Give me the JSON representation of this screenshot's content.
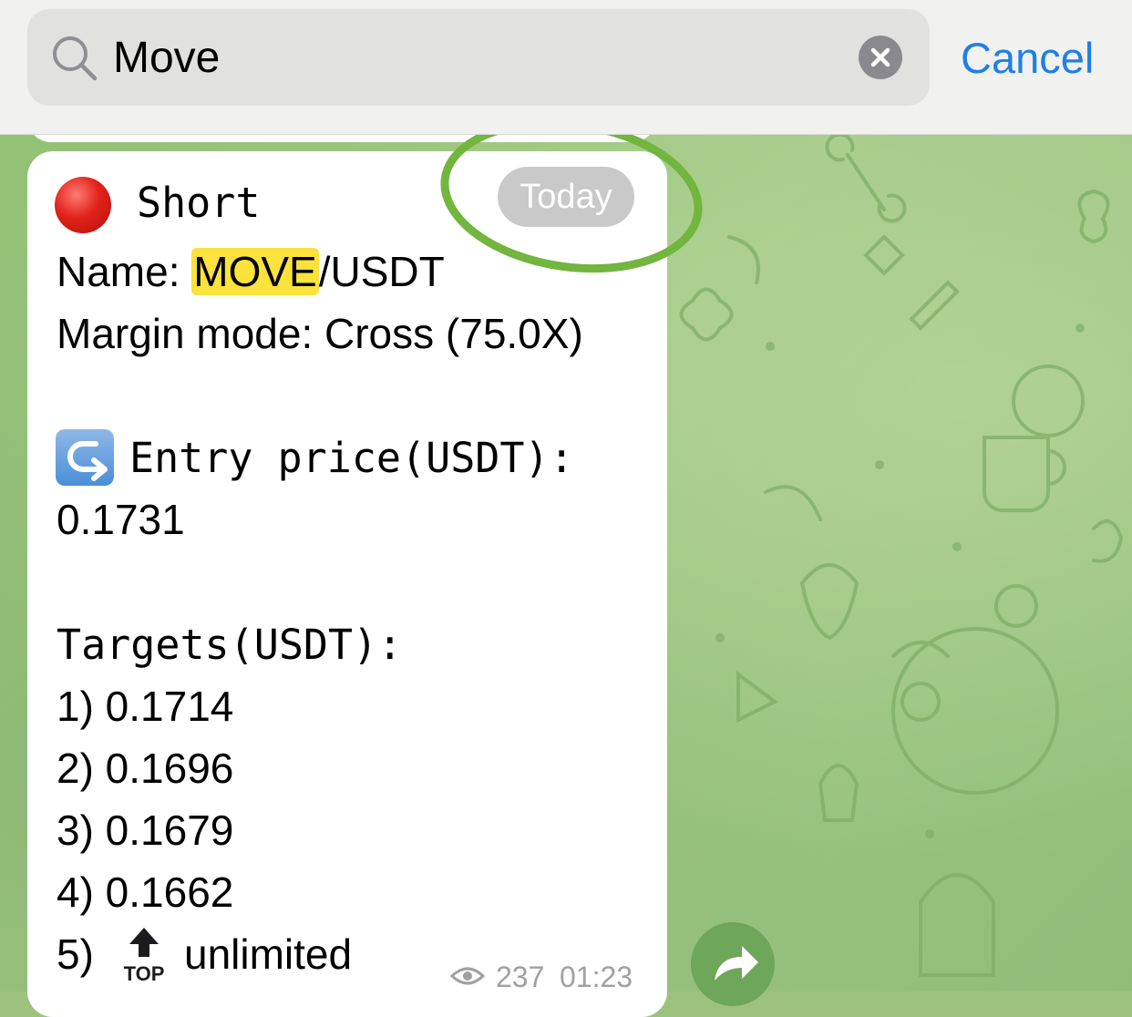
{
  "search": {
    "query": "Move",
    "cancel_label": "Cancel"
  },
  "message": {
    "date_badge": "Today",
    "direction": "Short",
    "name_label": "Name: ",
    "name_highlight": "MOVE",
    "name_rest": "/USDT",
    "margin_mode": "Margin mode: Cross (75.0X)",
    "entry_label": "Entry price(USDT):",
    "entry_value": "0.1731",
    "targets_label": "Targets(USDT):",
    "targets": [
      "1) 0.1714",
      "2) 0.1696",
      "3) 0.1679",
      "4) 0.1662"
    ],
    "target5_prefix": "5)",
    "target5_text": "unlimited",
    "views": "237",
    "time": "01:23"
  },
  "icons": {
    "search": "search-icon",
    "clear": "clear-icon",
    "direction": "red-circle-icon",
    "entry": "return-arrow-icon",
    "top": "top-arrow-icon",
    "views": "eye-icon",
    "forward": "forward-arrow-icon"
  },
  "colors": {
    "accent": "#1f7fe6",
    "highlight": "#fbe23c",
    "annotation": "#72b53f",
    "chat_background": "#9cc27e"
  }
}
